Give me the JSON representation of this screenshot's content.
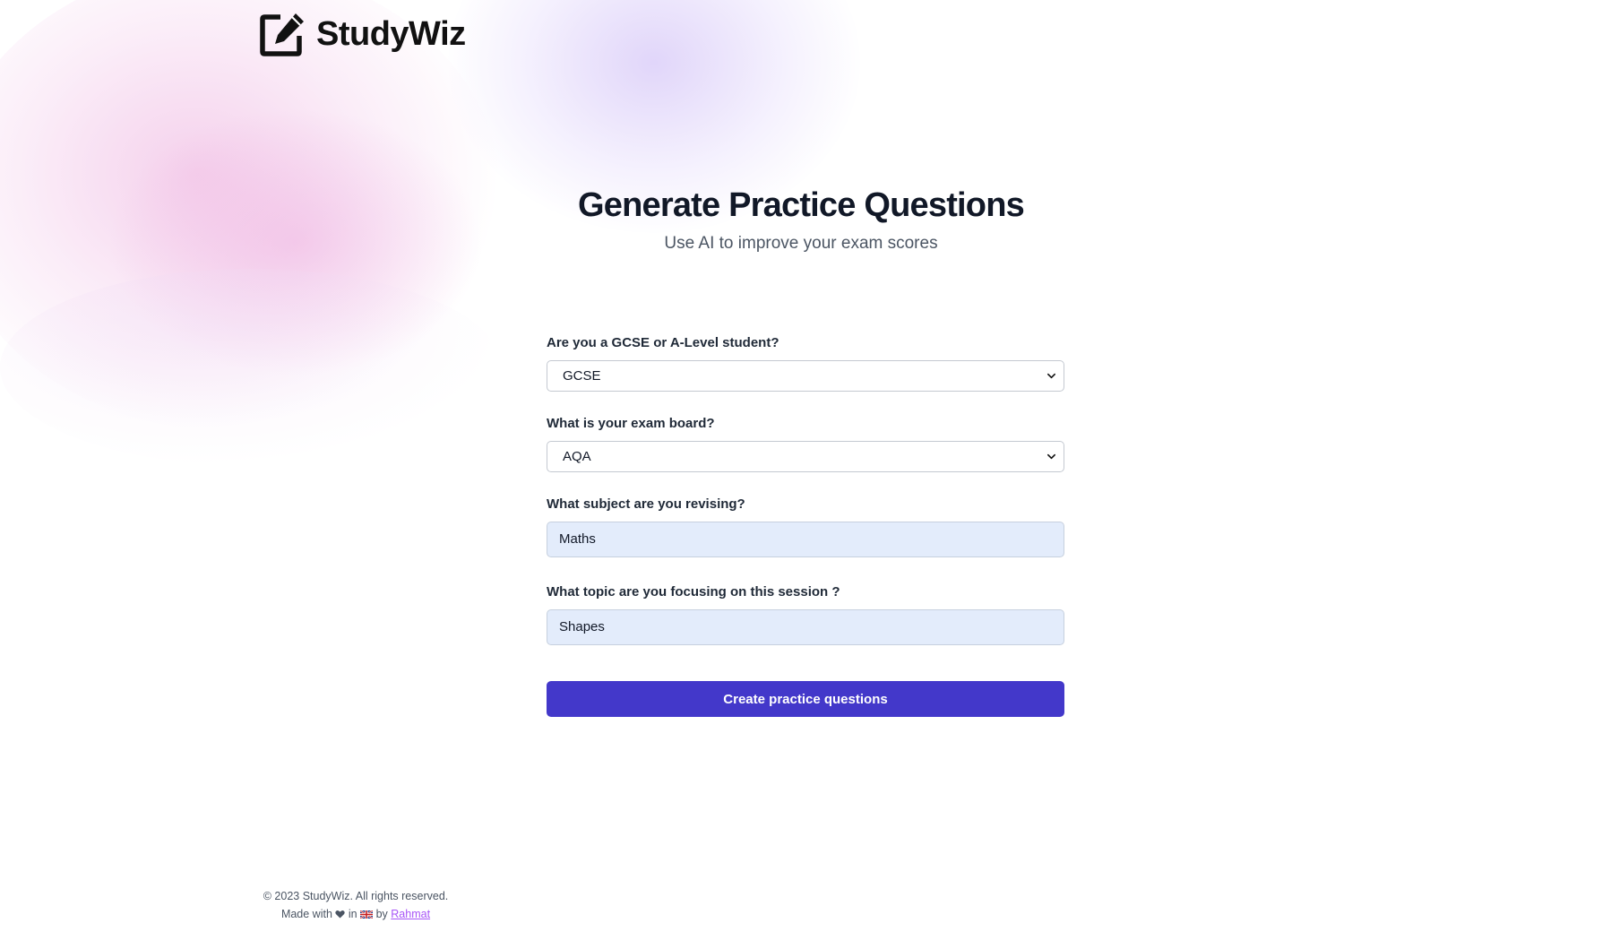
{
  "brand": {
    "name": "StudyWiz",
    "logo_icon": "edit-square-icon"
  },
  "hero": {
    "title": "Generate Practice Questions",
    "subtitle": "Use AI to improve your exam scores"
  },
  "form": {
    "level": {
      "label": "Are you a GCSE or A-Level student?",
      "value": "GCSE"
    },
    "board": {
      "label": "What is your exam board?",
      "value": "AQA"
    },
    "subject": {
      "label": "What subject are you revising?",
      "value": "Maths"
    },
    "topic": {
      "label": "What topic are you focusing on this session ?",
      "value": "Shapes"
    },
    "submit_label": "Create practice questions"
  },
  "footer": {
    "copyright": "© 2023 StudyWiz. All rights reserved.",
    "made_with": "Made with",
    "heart_icon": "heart-icon",
    "in_text": "in",
    "flag_icon": "uk-flag-icon",
    "by_text": "by",
    "author": "Rahmat"
  },
  "colors": {
    "accent": "#4338ca",
    "link": "#a855f7",
    "input_fill": "#e3ecfb"
  }
}
